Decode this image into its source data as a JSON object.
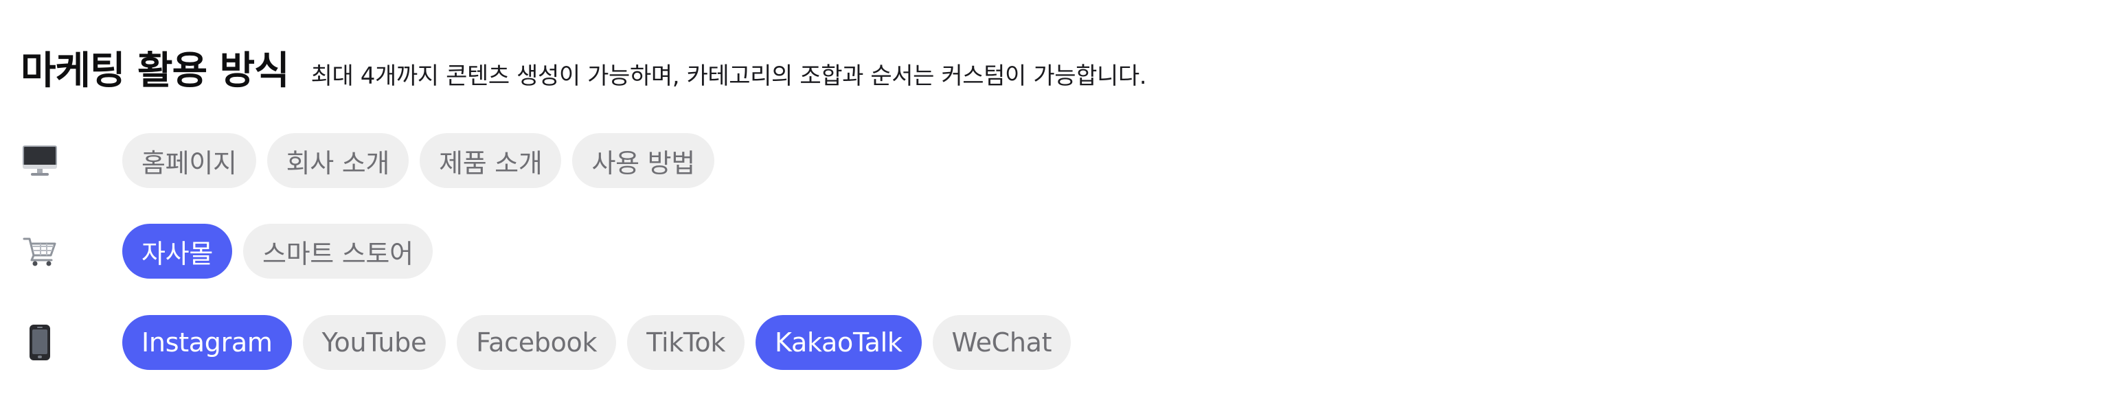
{
  "header": {
    "title": "마케팅 활용 방식",
    "subtitle": "최대 4개까지 콘텐츠 생성이 가능하며, 카테고리의 조합과 순서는 커스텀이 가능합니다."
  },
  "rows": [
    {
      "icon": "desktop-computer-icon",
      "chips": [
        {
          "label": "홈페이지",
          "selected": false
        },
        {
          "label": "회사 소개",
          "selected": false
        },
        {
          "label": "제품 소개",
          "selected": false
        },
        {
          "label": "사용 방법",
          "selected": false
        }
      ]
    },
    {
      "icon": "shopping-cart-icon",
      "chips": [
        {
          "label": "자사몰",
          "selected": true
        },
        {
          "label": "스마트 스토어",
          "selected": false
        }
      ]
    },
    {
      "icon": "mobile-phone-icon",
      "chips": [
        {
          "label": "Instagram",
          "selected": true
        },
        {
          "label": "YouTube",
          "selected": false
        },
        {
          "label": "Facebook",
          "selected": false
        },
        {
          "label": "TikTok",
          "selected": false
        },
        {
          "label": "KakaoTalk",
          "selected": true
        },
        {
          "label": "WeChat",
          "selected": false
        }
      ]
    }
  ],
  "colors": {
    "selected_bg": "#4f5ff5",
    "selected_text": "#ffffff",
    "unselected_bg": "#efefef",
    "unselected_text": "#6f6f74"
  }
}
